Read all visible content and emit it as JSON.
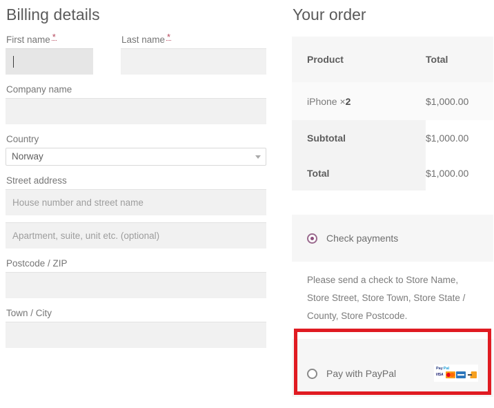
{
  "billing": {
    "title": "Billing details",
    "fields": {
      "first_name": {
        "label": "First name",
        "required_mark": "*",
        "value": "",
        "placeholder": ""
      },
      "last_name": {
        "label": "Last name",
        "required_mark": "*",
        "value": "",
        "placeholder": ""
      },
      "company": {
        "label": "Company name",
        "value": "",
        "placeholder": ""
      },
      "country": {
        "label": "Country",
        "value": "Norway"
      },
      "street": {
        "label": "Street address",
        "value": "",
        "placeholder": "House number and street name"
      },
      "street2": {
        "label": "",
        "value": "",
        "placeholder": "Apartment, suite, unit etc. (optional)"
      },
      "postcode": {
        "label": "Postcode / ZIP",
        "value": "",
        "placeholder": ""
      },
      "city": {
        "label": "Town / City",
        "value": "",
        "placeholder": ""
      }
    }
  },
  "order": {
    "title": "Your order",
    "table": {
      "headers": [
        "Product",
        "Total"
      ],
      "items": [
        {
          "name": "iPhone",
          "times": "×",
          "qty": "2",
          "total": "$1,000.00"
        }
      ],
      "summary": [
        {
          "label": "Subtotal",
          "value": "$1,000.00"
        },
        {
          "label": "Total",
          "value": "$1,000.00"
        }
      ]
    },
    "payment": {
      "methods": [
        {
          "id": "cheque",
          "label": "Check payments",
          "selected": true,
          "description": "Please send a check to Store Name, Store Street, Store Town, Store State / County, Store Postcode."
        },
        {
          "id": "paypal",
          "label": "Pay with PayPal",
          "selected": false,
          "cards": [
            "paypal-logo",
            "visa-card-icon",
            "mastercard-card-icon",
            "amex-card-icon",
            "discover-card-icon"
          ],
          "paypal_logo": {
            "part1": "Pay",
            "part2": "Pal"
          }
        }
      ]
    }
  },
  "annotation": {
    "highlight_color": "#e01b22",
    "target": "paypal-payment-method"
  },
  "colors": {
    "accent_radio": "#8e4f7d",
    "panel_bg": "#f6f6f6",
    "input_bg": "#f1f1f1",
    "input_focus_bg": "#e6e6e6",
    "required": "#b5485c"
  }
}
